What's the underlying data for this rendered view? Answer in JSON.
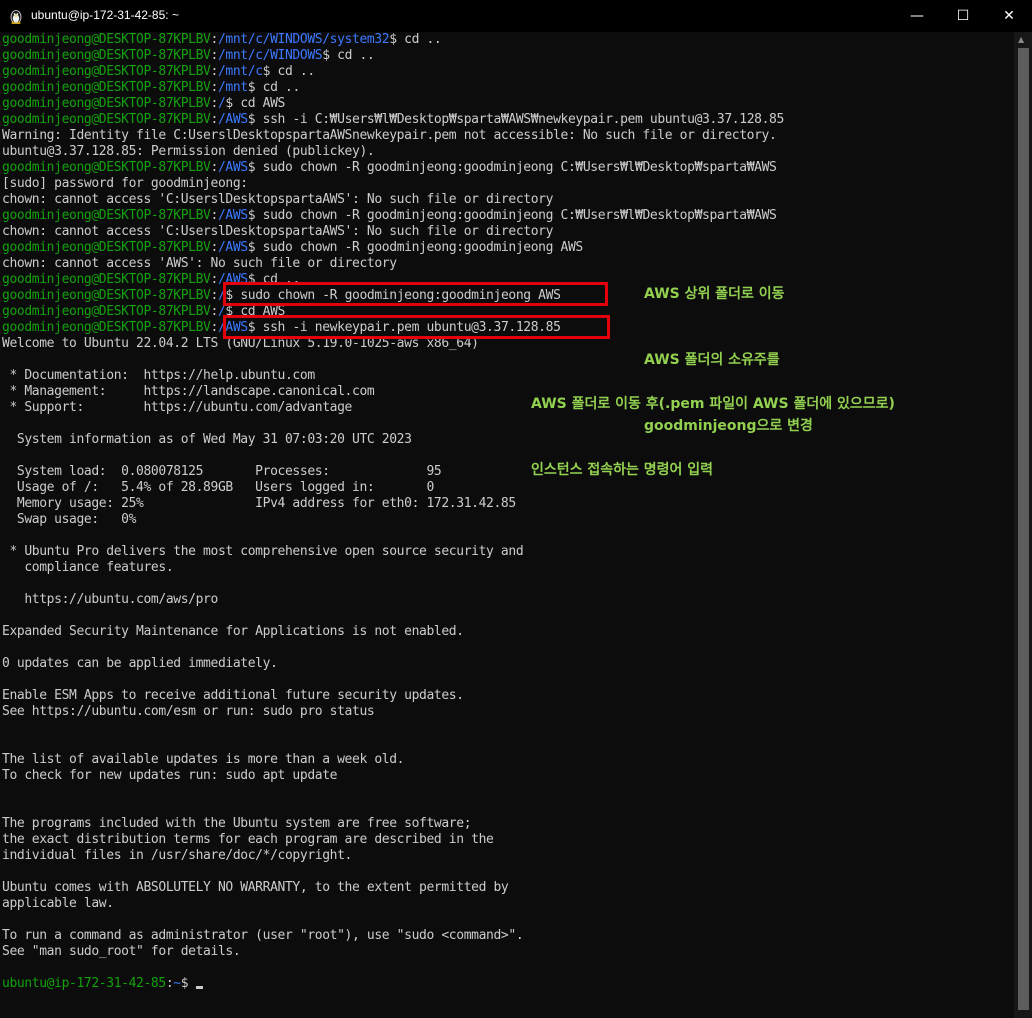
{
  "window": {
    "title": "ubuntu@ip-172-31-42-85: ~",
    "icon": "tux-icon",
    "controls": {
      "minimize": "—",
      "maximize": "☐",
      "close": "✕"
    }
  },
  "colors": {
    "user": "#13a10e",
    "path": "#3b78ff",
    "text": "#cccccc",
    "annotation_box": "#e3000b",
    "annotation_text": "#92d050"
  },
  "terminal": {
    "lines": [
      {
        "user": "goodminjeong@DESKTOP-87KPLBV",
        "path": "/mnt/c/WINDOWS/system32",
        "cmd": "$ cd .."
      },
      {
        "user": "goodminjeong@DESKTOP-87KPLBV",
        "path": "/mnt/c/WINDOWS",
        "cmd": "$ cd .."
      },
      {
        "user": "goodminjeong@DESKTOP-87KPLBV",
        "path": "/mnt/c",
        "cmd": "$ cd .."
      },
      {
        "user": "goodminjeong@DESKTOP-87KPLBV",
        "path": "/mnt",
        "cmd": "$ cd .."
      },
      {
        "user": "goodminjeong@DESKTOP-87KPLBV",
        "path": "/",
        "cmd": "$ cd AWS"
      },
      {
        "user": "goodminjeong@DESKTOP-87KPLBV",
        "path": "/AWS",
        "cmd": "$ ssh -i C:₩Users₩l₩Desktop₩sparta₩AWS₩newkeypair.pem ubuntu@3.37.128.85"
      },
      {
        "text": "Warning: Identity file C:UserslDesktopspartaAWSnewkeypair.pem not accessible: No such file or directory."
      },
      {
        "text": "ubuntu@3.37.128.85: Permission denied (publickey)."
      },
      {
        "user": "goodminjeong@DESKTOP-87KPLBV",
        "path": "/AWS",
        "cmd": "$ sudo chown -R goodminjeong:goodminjeong C:₩Users₩l₩Desktop₩sparta₩AWS"
      },
      {
        "text": "[sudo] password for goodminjeong:"
      },
      {
        "text": "chown: cannot access 'C:UserslDesktopspartaAWS': No such file or directory"
      },
      {
        "user": "goodminjeong@DESKTOP-87KPLBV",
        "path": "/AWS",
        "cmd": "$ sudo chown -R goodminjeong:goodminjeong C:₩Users₩l₩Desktop₩sparta₩AWS"
      },
      {
        "text": "chown: cannot access 'C:UserslDesktopspartaAWS': No such file or directory"
      },
      {
        "user": "goodminjeong@DESKTOP-87KPLBV",
        "path": "/AWS",
        "cmd": "$ sudo chown -R goodminjeong:goodminjeong AWS"
      },
      {
        "text": "chown: cannot access 'AWS': No such file or directory"
      },
      {
        "user": "goodminjeong@DESKTOP-87KPLBV",
        "path": "/AWS",
        "cmd": "$ cd .."
      },
      {
        "user": "goodminjeong@DESKTOP-87KPLBV",
        "path": "/",
        "cmd": "$ sudo chown -R goodminjeong:goodminjeong AWS"
      },
      {
        "user": "goodminjeong@DESKTOP-87KPLBV",
        "path": "/",
        "cmd": "$ cd AWS"
      },
      {
        "user": "goodminjeong@DESKTOP-87KPLBV",
        "path": "/AWS",
        "cmd": "$ ssh -i newkeypair.pem ubuntu@3.37.128.85"
      },
      {
        "text": "Welcome to Ubuntu 22.04.2 LTS (GNU/Linux 5.19.0-1025-aws x86_64)"
      },
      {
        "text": ""
      },
      {
        "text": " * Documentation:  https://help.ubuntu.com"
      },
      {
        "text": " * Management:     https://landscape.canonical.com"
      },
      {
        "text": " * Support:        https://ubuntu.com/advantage"
      },
      {
        "text": ""
      },
      {
        "text": "  System information as of Wed May 31 07:03:20 UTC 2023"
      },
      {
        "text": ""
      },
      {
        "text": "  System load:  0.080078125       Processes:             95"
      },
      {
        "text": "  Usage of /:   5.4% of 28.89GB   Users logged in:       0"
      },
      {
        "text": "  Memory usage: 25%               IPv4 address for eth0: 172.31.42.85"
      },
      {
        "text": "  Swap usage:   0%"
      },
      {
        "text": ""
      },
      {
        "text": " * Ubuntu Pro delivers the most comprehensive open source security and"
      },
      {
        "text": "   compliance features."
      },
      {
        "text": ""
      },
      {
        "text": "   https://ubuntu.com/aws/pro"
      },
      {
        "text": ""
      },
      {
        "text": "Expanded Security Maintenance for Applications is not enabled."
      },
      {
        "text": ""
      },
      {
        "text": "0 updates can be applied immediately."
      },
      {
        "text": ""
      },
      {
        "text": "Enable ESM Apps to receive additional future security updates."
      },
      {
        "text": "See https://ubuntu.com/esm or run: sudo pro status"
      },
      {
        "text": ""
      },
      {
        "text": ""
      },
      {
        "text": "The list of available updates is more than a week old."
      },
      {
        "text": "To check for new updates run: sudo apt update"
      },
      {
        "text": ""
      },
      {
        "text": ""
      },
      {
        "text": "The programs included with the Ubuntu system are free software;"
      },
      {
        "text": "the exact distribution terms for each program are described in the"
      },
      {
        "text": "individual files in /usr/share/doc/*/copyright."
      },
      {
        "text": ""
      },
      {
        "text": "Ubuntu comes with ABSOLUTELY NO WARRANTY, to the extent permitted by"
      },
      {
        "text": "applicable law."
      },
      {
        "text": ""
      },
      {
        "text": "To run a command as administrator (user \"root\"), use \"sudo <command>\"."
      },
      {
        "text": "See \"man sudo_root\" for details."
      },
      {
        "text": ""
      },
      {
        "user": "ubuntu@ip-172-31-42-85",
        "path": "~",
        "cmd": "$",
        "cursor": true
      }
    ]
  },
  "annotations": {
    "note1": [
      "AWS 상위 폴더로 이동",
      "AWS 폴더의 소유주를",
      "goodminjeong으로 변경"
    ],
    "note2": [
      "AWS 폴더로 이동 후(.pem 파일이 AWS 폴더에 있으므로)",
      "인스턴스 접속하는 명령어 입력"
    ]
  }
}
